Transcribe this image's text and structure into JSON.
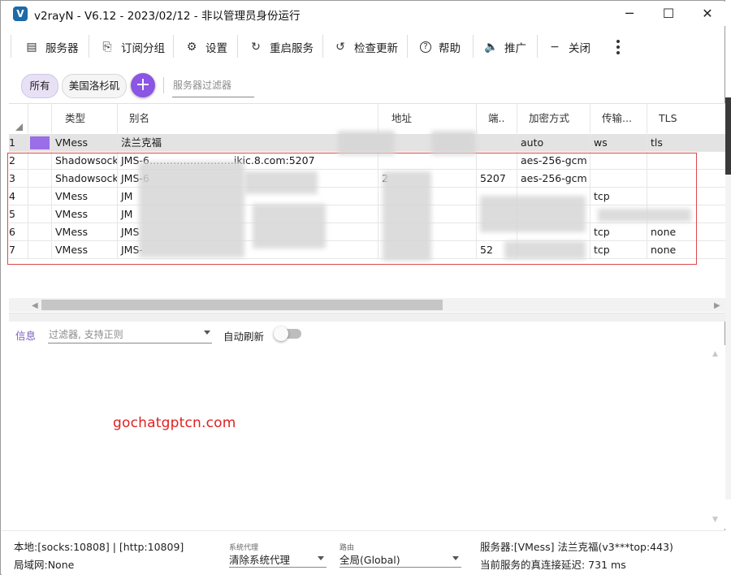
{
  "window": {
    "title": "v2rayN - V6.12 - 2023/02/12 - 非以管理员身份运行",
    "logo_letter": "V",
    "minimize_glyph": "─",
    "maximize_glyph": "☐",
    "close_glyph": "✕"
  },
  "toolbar": {
    "servers": {
      "label": "服务器",
      "icon": "server-icon",
      "glyph": "▤"
    },
    "subscription": {
      "label": "订阅分组",
      "icon": "subscription-icon",
      "glyph": "⎘"
    },
    "settings": {
      "label": "设置",
      "icon": "gear-icon",
      "glyph": "⚙"
    },
    "restart": {
      "label": "重启服务",
      "icon": "restart-icon",
      "glyph": "↻"
    },
    "check_update": {
      "label": "检查更新",
      "icon": "update-icon",
      "glyph": "↺"
    },
    "help": {
      "label": "帮助",
      "icon": "help-icon",
      "glyph": "?"
    },
    "promote": {
      "label": "推广",
      "icon": "speaker-icon",
      "glyph": "🔈"
    },
    "close": {
      "label": "关闭",
      "icon": "minus-icon",
      "glyph": "−"
    }
  },
  "filters": {
    "chips": [
      "所有",
      "美国洛杉矶"
    ],
    "active_chip": "所有",
    "add_glyph": "+",
    "server_filter_placeholder": "服务器过滤器"
  },
  "grid": {
    "columns": [
      "类型",
      "别名",
      "地址",
      "端..",
      "加密方式",
      "传输...",
      "TLS"
    ],
    "rows": [
      {
        "index": "1",
        "type": "VMess",
        "alias": "法兰克福",
        "address": "",
        "port": "",
        "security": "auto",
        "network": "ws",
        "tls": "tls",
        "selected": true
      },
      {
        "index": "2",
        "type": "Shadowsocks",
        "alias": "JMS-6…………………….ikic.8.com:5207",
        "address": "",
        "port": "",
        "security": "aes-256-gcm",
        "network": "",
        "tls": ""
      },
      {
        "index": "3",
        "type": "Shadowsocks",
        "alias": "JMS-6",
        "address": "2",
        "port": "5207",
        "security": "aes-256-gcm",
        "network": "",
        "tls": ""
      },
      {
        "index": "4",
        "type": "VMess",
        "alias": "JM",
        "address": "",
        "port": "",
        "security": "",
        "network": "tcp",
        "tls": ""
      },
      {
        "index": "5",
        "type": "VMess",
        "alias": "JM",
        "address": "",
        "port": "",
        "security": "",
        "network": "",
        "tls": ""
      },
      {
        "index": "6",
        "type": "VMess",
        "alias": "JMS",
        "address": "",
        "port": "",
        "security": "",
        "network": "tcp",
        "tls": "none"
      },
      {
        "index": "7",
        "type": "VMess",
        "alias": "JMS-",
        "address": "",
        "port": "52",
        "security": "",
        "network": "tcp",
        "tls": "none"
      }
    ]
  },
  "log": {
    "tab_label": "信息",
    "filter_placeholder": "过滤器, 支持正则",
    "autorefresh_label": "自动刷新",
    "autorefresh_on": false,
    "watermark": "gochatgptcn.com"
  },
  "status": {
    "local": "本地:[socks:10808] | [http:10809]",
    "lan": "局域网:None",
    "proxy_caption": "系统代理",
    "proxy_value": "清除系统代理",
    "routing_caption": "路由",
    "routing_value": "全局(Global)",
    "server_info": "服务器:[VMess] 法兰克福(v3***top:443)",
    "latency": "当前服务的真连接延迟: 731 ms"
  },
  "colors": {
    "accent": "#8b56e3",
    "selected_swatch": "#9a6ee6",
    "outline_red": "#e04848",
    "watermark_red": "#e02020"
  }
}
